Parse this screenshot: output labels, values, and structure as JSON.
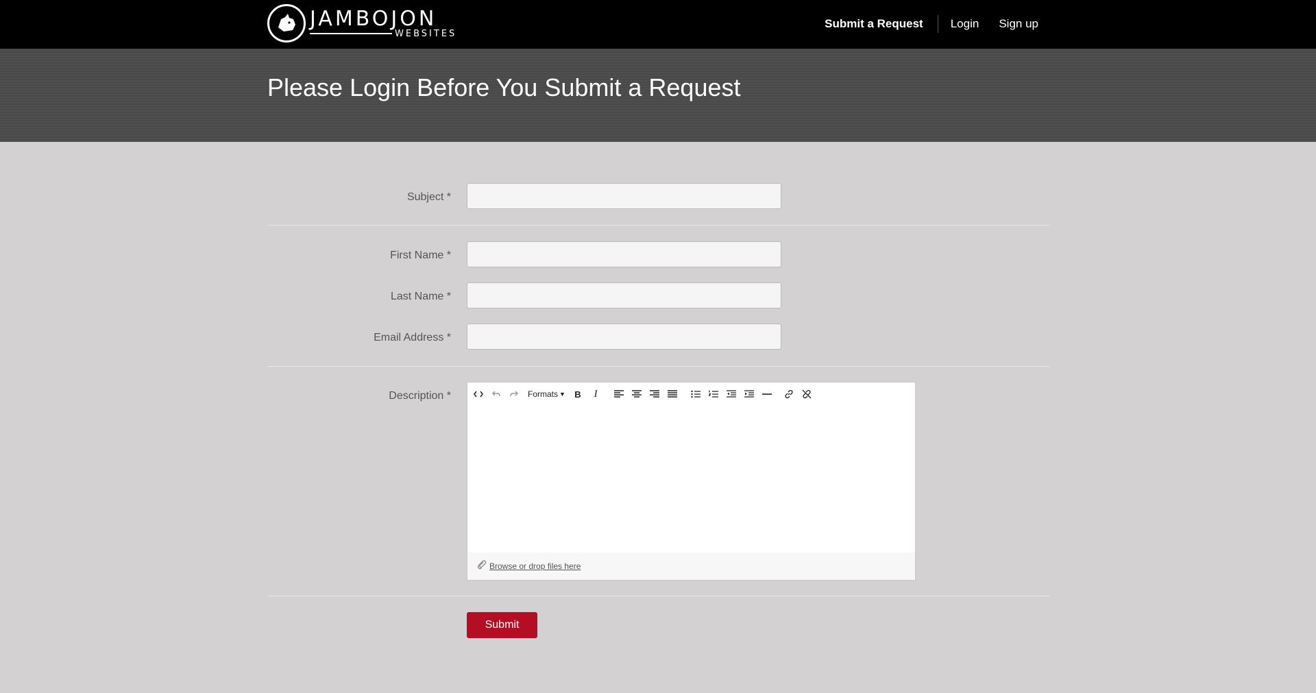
{
  "logo": {
    "main": "JAMBOJON",
    "sub": "WEBSITES"
  },
  "nav": {
    "submit_request": "Submit a Request",
    "login": "Login",
    "signup": "Sign up"
  },
  "hero": {
    "title": "Please Login Before You Submit a Request"
  },
  "form": {
    "subject_label": "Subject *",
    "first_name_label": "First Name *",
    "last_name_label": "Last Name *",
    "email_label": "Email Address *",
    "description_label": "Description *",
    "toolbar": {
      "formats_label": "Formats"
    },
    "attach_text": "Browse or drop files here",
    "submit_label": "Submit"
  }
}
